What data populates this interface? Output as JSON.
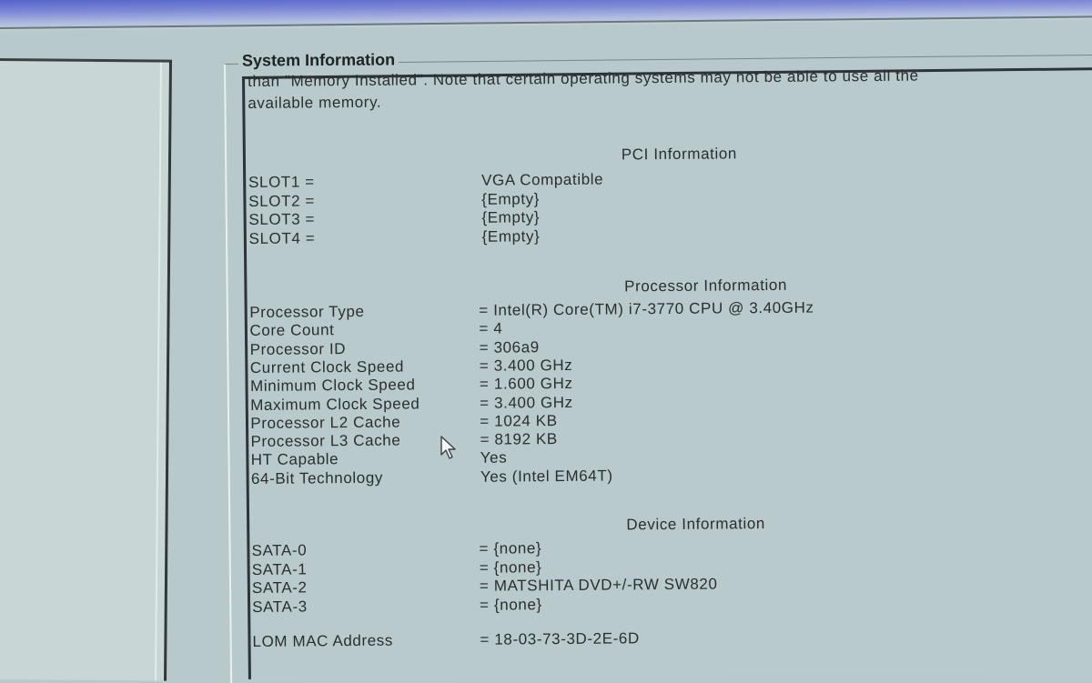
{
  "window": {
    "group_title": "System Information"
  },
  "intro": {
    "line1": "than \"Memory Installed\". Note that certain operating systems may not be able to use all the",
    "line2": "available memory."
  },
  "pci": {
    "title": "PCI Information",
    "rows": [
      {
        "label": "SLOT1 =",
        "value": "VGA Compatible"
      },
      {
        "label": "SLOT2 =",
        "value": "{Empty}"
      },
      {
        "label": "SLOT3 =",
        "value": "{Empty}"
      },
      {
        "label": "SLOT4 =",
        "value": "{Empty}"
      }
    ]
  },
  "processor": {
    "title": "Processor Information",
    "rows": [
      {
        "label": "Processor Type",
        "value": "= Intel(R) Core(TM) i7-3770 CPU @ 3.40GHz"
      },
      {
        "label": "Core Count",
        "value": "= 4"
      },
      {
        "label": "Processor ID",
        "value": "= 306a9"
      },
      {
        "label": "Current Clock Speed",
        "value": "= 3.400 GHz"
      },
      {
        "label": "Minimum Clock Speed",
        "value": "= 1.600 GHz"
      },
      {
        "label": "Maximum Clock Speed",
        "value": "= 3.400 GHz"
      },
      {
        "label": "Processor L2 Cache",
        "value": "= 1024 KB"
      },
      {
        "label": "Processor L3 Cache",
        "value": "= 8192 KB"
      },
      {
        "label": "HT Capable",
        "value": "Yes"
      },
      {
        "label": "64-Bit Technology",
        "value": "Yes (Intel EM64T)"
      }
    ]
  },
  "device": {
    "title": "Device Information",
    "rows": [
      {
        "label": "SATA-0",
        "value": "= {none}"
      },
      {
        "label": "SATA-1",
        "value": "= {none}"
      },
      {
        "label": "SATA-2",
        "value": "= MATSHITA DVD+/-RW SW820"
      },
      {
        "label": "SATA-3",
        "value": "= {none}"
      }
    ],
    "mac": {
      "label": "LOM MAC Address",
      "value": "= 18-03-73-3D-2E-6D"
    }
  }
}
